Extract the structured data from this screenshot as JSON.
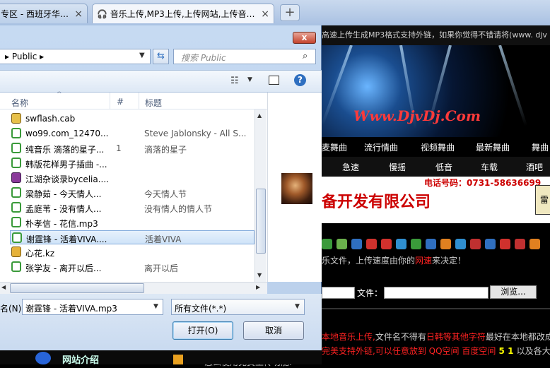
{
  "browser": {
    "tabs": [
      {
        "label": "专区 - 西班牙华…",
        "close": "×"
      },
      {
        "label": "音乐上传,MP3上传,上传网站,上传音…",
        "close": "×"
      }
    ],
    "new_tab": "+"
  },
  "webpage": {
    "topbar_text": "高速上传生成MP3格式支持外链，如果你觉得不错请将(www. djv",
    "logo": "Www.DjvDj.Com",
    "nav1": [
      "麦舞曲",
      "流行情曲",
      "视频舞曲",
      "最新舞曲",
      "舞曲"
    ],
    "nav2": [
      "急速",
      "慢摇",
      "低音",
      "车载",
      "酒吧"
    ],
    "phone": "电话号码：0731-58636699",
    "company": "备开发有限公司",
    "ad_box": "雷",
    "notice_a": "乐文件，上传速度由你的",
    "notice_red": "网速",
    "notice_b": "来决定！",
    "file_label": "文件：",
    "browse_button": "浏览...",
    "warn1_a": "本地音乐上传,",
    "warn1_b": "文件名不得有",
    "warn1_c": "日韩等其他字符",
    "warn1_d": "最好在本地都改成",
    "warn2_a": "完美支持外链,可以任意放到 ",
    "warn2_b": "QQ空间 百度空间",
    "warn2_c": " 5 1 ",
    "warn2_d": "以及各大",
    "howto": "怎么使用免费上传功能:",
    "site_intro": "网站介绍"
  },
  "dialog": {
    "close": "x",
    "address": "Public",
    "search_placeholder": "搜索 Public",
    "columns": {
      "name": "名称",
      "number": "#",
      "title": "标题"
    },
    "files": [
      {
        "name": "swflash.cab",
        "num": "",
        "title": "",
        "type": "cab"
      },
      {
        "name": "wo99.com_12470...",
        "num": "",
        "title": "Steve Jablonsky - All S...",
        "type": "mp3"
      },
      {
        "name": "纯音乐 滴落的星子...",
        "num": "1",
        "title": "滴落的星子",
        "type": "mp3"
      },
      {
        "name": "韩版花样男子插曲 -...",
        "num": "",
        "title": "",
        "type": "mp3"
      },
      {
        "name": "江湖杂谈录bycelia....",
        "num": "",
        "title": "",
        "type": "rar"
      },
      {
        "name": "梁静茹 - 今天情人...",
        "num": "",
        "title": "今天情人节",
        "type": "mp3"
      },
      {
        "name": "孟庭苇 - 没有情人...",
        "num": "",
        "title": "没有情人的情人节",
        "type": "mp3"
      },
      {
        "name": "朴孝信 - 花信.mp3",
        "num": "",
        "title": "",
        "type": "mp3"
      },
      {
        "name": "谢霆锋 - 活着VIVA....",
        "num": "",
        "title": "活着VIVA",
        "type": "mp3",
        "selected": true
      },
      {
        "name": "心花.kz",
        "num": "",
        "title": "",
        "type": "kz"
      },
      {
        "name": "张学友 - 离开以后...",
        "num": "",
        "title": "离开以后",
        "type": "mp3"
      }
    ],
    "filename_label": "名(N):",
    "filename_value": "谢霆锋 - 活着VIVA.mp3",
    "filetype_value": "所有文件(*.*)",
    "open_button": "打开(O)",
    "cancel_button": "取消"
  }
}
